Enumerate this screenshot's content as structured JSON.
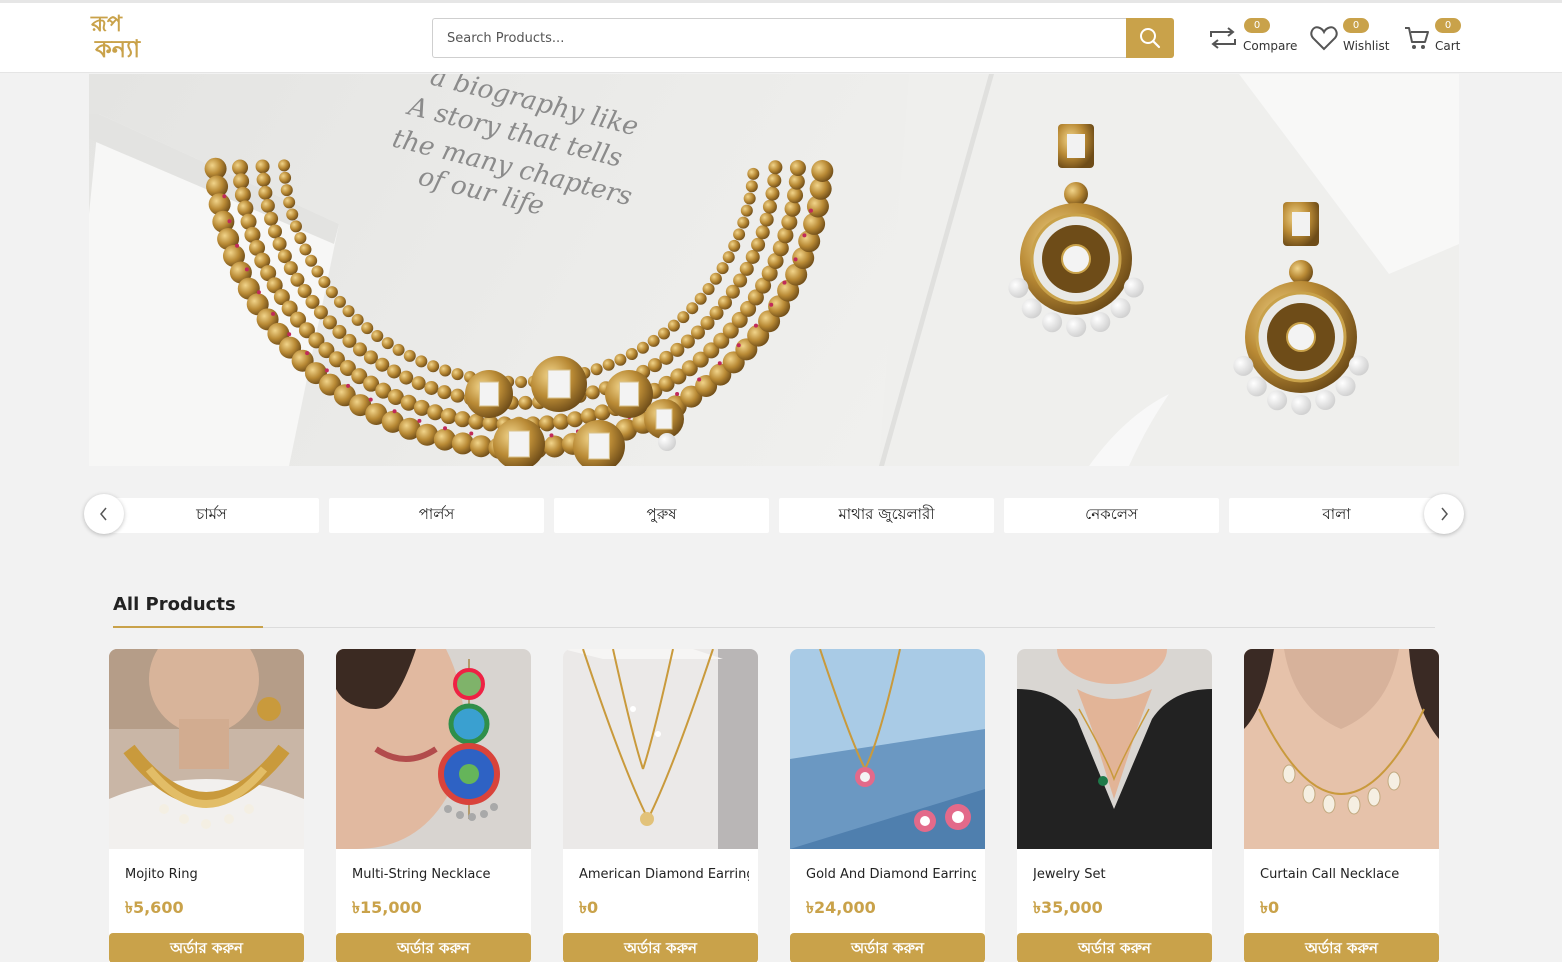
{
  "header": {
    "logo_line1": "রূপ",
    "logo_line2": "কন্যা",
    "search_placeholder": "Search Products...",
    "compare": {
      "label": "Compare",
      "count": "0"
    },
    "wishlist": {
      "label": "Wishlist",
      "count": "0"
    },
    "cart": {
      "label": "Cart",
      "count": "0"
    }
  },
  "hero": {
    "quote_lines": [
      "a biography like",
      "A story that tells",
      "the many chapters",
      "of our life"
    ]
  },
  "categories": [
    "চার্মস",
    "পার্লস",
    "পুরুষ",
    "মাথার জুয়েলারী",
    "নেকলেস",
    "বালা"
  ],
  "section": {
    "title": "All Products"
  },
  "products": [
    {
      "name": "Mojito Ring",
      "price": "৳5,600",
      "order_label": "অর্ডার করুন"
    },
    {
      "name": "Multi-String Necklace",
      "price": "৳15,000",
      "order_label": "অর্ডার করুন"
    },
    {
      "name": "American Diamond Earring",
      "price": "৳0",
      "order_label": "অর্ডার করুন"
    },
    {
      "name": "Gold And Diamond Earring",
      "price": "৳24,000",
      "order_label": "অর্ডার করুন"
    },
    {
      "name": "Jewelry Set",
      "price": "৳35,000",
      "order_label": "অর্ডার করুন"
    },
    {
      "name": "Curtain Call Necklace",
      "price": "৳0",
      "order_label": "অর্ডার করুন"
    }
  ],
  "colors": {
    "accent": "#c9a24a",
    "background": "#f2f2f2"
  }
}
